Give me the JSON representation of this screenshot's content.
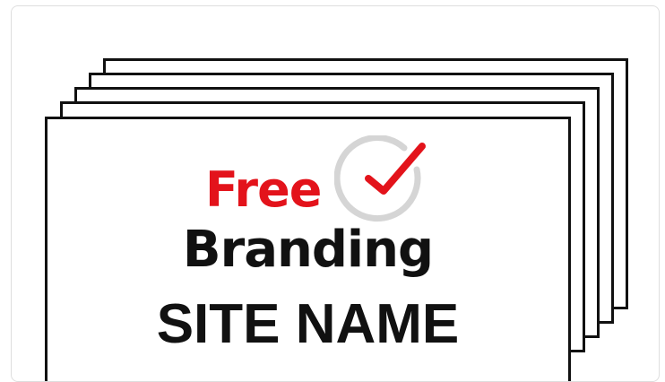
{
  "branding_card": {
    "free_label": "Free",
    "branding_label": "Branding",
    "site_name": "SITE NAME",
    "check_icon": "checkmark-circle-icon",
    "sheet_count": 5
  },
  "colors": {
    "accent_red": "#e3131b",
    "text_black": "#111111",
    "ring_gray": "#d5d5d5",
    "card_border": "#dedede"
  }
}
